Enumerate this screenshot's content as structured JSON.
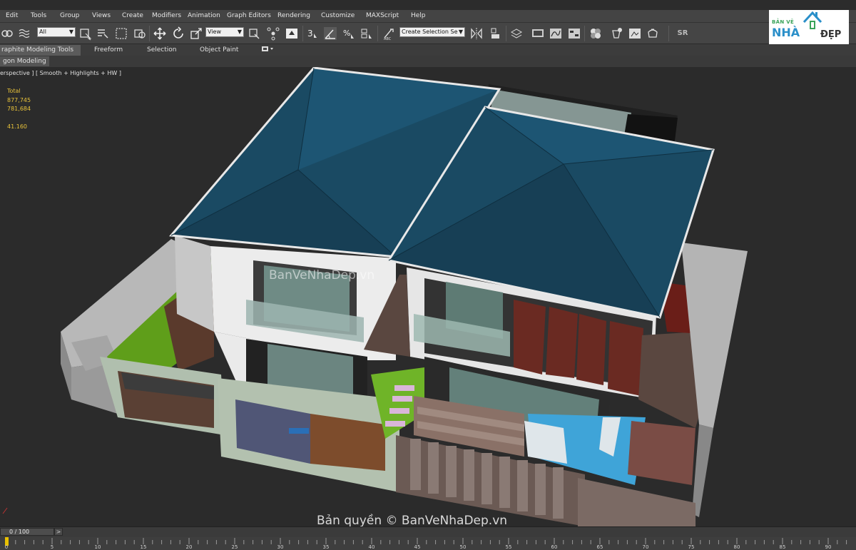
{
  "menu": [
    "Edit",
    "Tools",
    "Group",
    "Views",
    "Create",
    "Modifiers",
    "Animation",
    "Graph Editors",
    "Rendering",
    "Customize",
    "MAXScript",
    "Help"
  ],
  "toolbar": {
    "filter_value": "All",
    "coord_value": "View",
    "selection_set_value": "Create Selection Se",
    "snap_label": "3",
    "sr_label": "SR",
    "icons": [
      "link-icon",
      "bind-spacewarp-icon",
      "select-object-icon",
      "select-by-name-icon",
      "rectangular-region-icon",
      "window-crossing-icon",
      "move-icon",
      "rotate-icon",
      "scale-icon",
      "pivot-icon",
      "manipulate-icon",
      "snap-toggle-icon",
      "angle-snap-icon",
      "percent-snap-icon",
      "spinner-snap-icon",
      "edit-named-selection-icon",
      "mirror-icon",
      "align-icon",
      "layer-manager-icon",
      "graphite-toggle-icon",
      "curve-editor-icon",
      "schematic-view-icon",
      "material-editor-icon",
      "render-setup-icon",
      "rendered-frame-icon",
      "render-icon"
    ]
  },
  "ribbon": {
    "tabs": [
      "raphite Modeling Tools",
      "Freeform",
      "Selection",
      "Object Paint"
    ],
    "active_tab": 0,
    "sub_tab": "gon Modeling"
  },
  "viewport": {
    "label": "erspective ] [ Smooth + Highlights + HW ]",
    "stats": {
      "title": "Total",
      "polys": "877,745",
      "verts": "781,684",
      "fps": "41.160"
    }
  },
  "logo": {
    "line1": "BẢN VẼ",
    "line2": "NHÀ",
    "line3": "ĐẸP"
  },
  "watermarks": {
    "center": "BanVeNhaDep.vn",
    "bottom": "Bản quyền © BanVeNhaDep.vn"
  },
  "timeline": {
    "slider_text": "0 / 100",
    "next_label": ">",
    "tick_labels": [
      "0",
      "5",
      "10",
      "15",
      "20",
      "25",
      "30",
      "35",
      "40",
      "45",
      "50",
      "55",
      "60",
      "65",
      "70",
      "75",
      "80",
      "85",
      "90"
    ]
  },
  "colors": {
    "roof": "#1a4a63",
    "lawn": "#5f9e1a",
    "pool": "#3fa4d8",
    "viewport_bg": "#2b2b2b",
    "stats": "#e8c23a"
  }
}
